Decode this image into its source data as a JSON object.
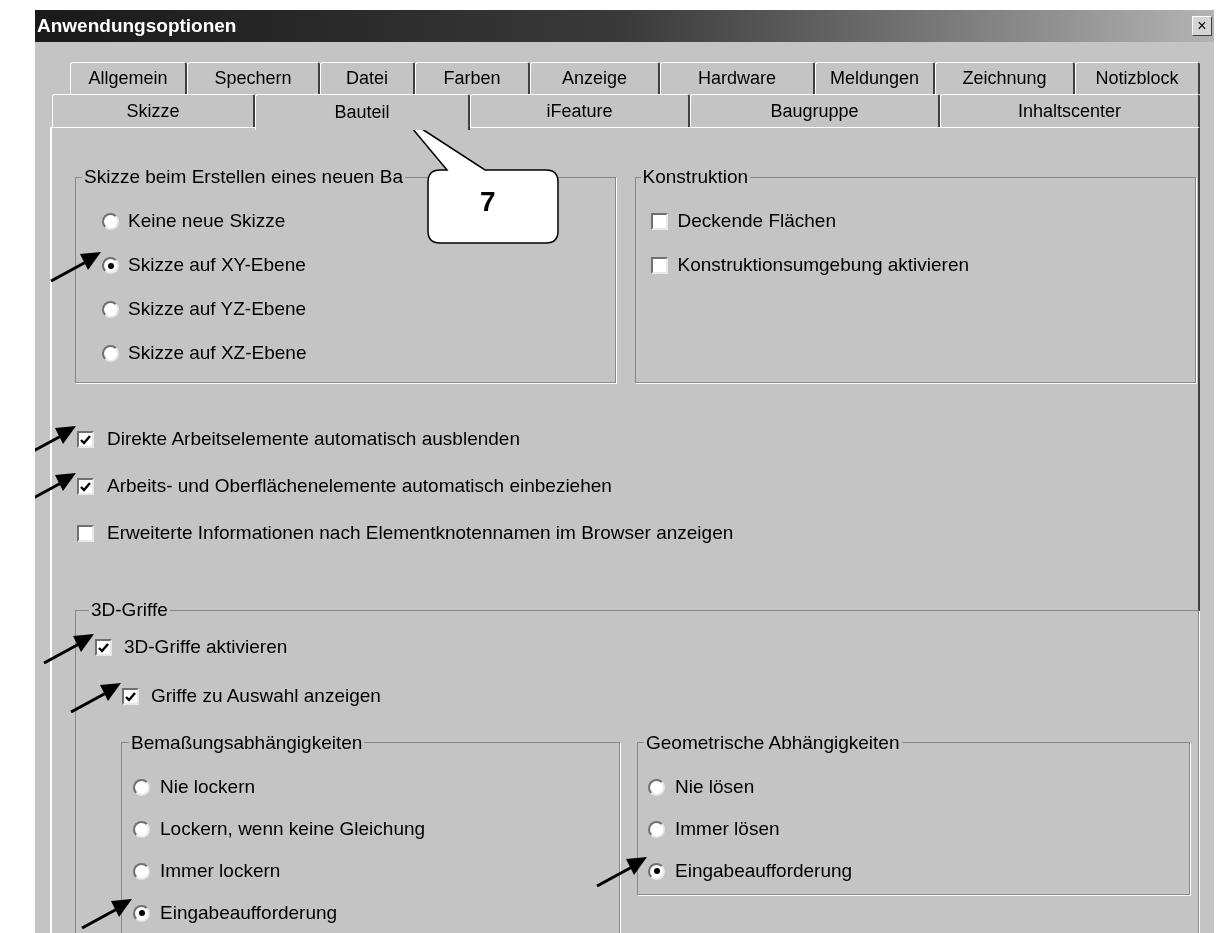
{
  "window": {
    "title": "Anwendungsoptionen",
    "close": "×"
  },
  "tab_rows": [
    [
      {
        "label": "Allgemein",
        "selected": false
      },
      {
        "label": "Spechern",
        "selected": false
      },
      {
        "label": "Datei",
        "selected": false
      },
      {
        "label": "Farben",
        "selected": false
      },
      {
        "label": "Anzeige",
        "selected": false
      },
      {
        "label": "Hardware",
        "selected": false
      },
      {
        "label": "Meldungen",
        "selected": false
      },
      {
        "label": "Zeichnung",
        "selected": false
      },
      {
        "label": "Notizblock",
        "selected": false
      }
    ],
    [
      {
        "label": "Skizze",
        "selected": false
      },
      {
        "label": "Bauteil",
        "selected": true
      },
      {
        "label": "iFeature",
        "selected": false
      },
      {
        "label": "Baugruppe",
        "selected": false
      },
      {
        "label": "Inhaltscenter",
        "selected": false
      }
    ]
  ],
  "callout": {
    "text": "7"
  },
  "sketch_group": {
    "title": "Skizze beim Erstellen eines neuen Ba",
    "options": [
      {
        "label": "Keine neue Skizze",
        "selected": false,
        "arrow": false
      },
      {
        "label": "Skizze auf  XY-Ebene",
        "selected": true,
        "arrow": true
      },
      {
        "label": "Skizze auf YZ-Ebene",
        "selected": false,
        "arrow": false
      },
      {
        "label": "Skizze auf XZ-Ebene",
        "selected": false,
        "arrow": false
      }
    ]
  },
  "construction_group": {
    "title": "Konstruktion",
    "options": [
      {
        "label": "Deckende Flächen",
        "checked": false
      },
      {
        "label": "Konstruktionsumgebung aktivieren",
        "checked": false
      }
    ]
  },
  "options": [
    {
      "label": "Direkte Arbeitselemente automatisch ausblenden",
      "checked": true,
      "arrow": true
    },
    {
      "label": "Arbeits- und Oberflächenelemente automatisch einbeziehen",
      "checked": true,
      "arrow": true
    },
    {
      "label": "Erweiterte Informationen nach Elementknotennamen im Browser anzeigen",
      "checked": false,
      "arrow": false
    }
  ],
  "grips_group": {
    "title": "3D-Griffe",
    "enable": {
      "label": "3D-Griffe aktivieren",
      "checked": true,
      "arrow": true
    },
    "show_on_selection": {
      "label": "Griffe zu Auswahl anzeigen",
      "checked": true,
      "arrow": true
    },
    "dimension_group": {
      "title": "Bemaßungsabhängigkeiten",
      "options": [
        {
          "label": "Nie lockern",
          "selected": false,
          "arrow": false
        },
        {
          "label": "Lockern, wenn keine Gleichung",
          "selected": false,
          "arrow": false
        },
        {
          "label": "Immer lockern",
          "selected": false,
          "arrow": false
        },
        {
          "label": "Eingabeaufforderung",
          "selected": true,
          "arrow": true
        }
      ]
    },
    "geometric_group": {
      "title": "Geometrische Abhängigkeiten",
      "options": [
        {
          "label": "Nie lösen",
          "selected": false,
          "arrow": false
        },
        {
          "label": "Immer lösen",
          "selected": false,
          "arrow": false
        },
        {
          "label": "Eingabeaufforderung",
          "selected": true,
          "arrow": true
        }
      ]
    }
  }
}
